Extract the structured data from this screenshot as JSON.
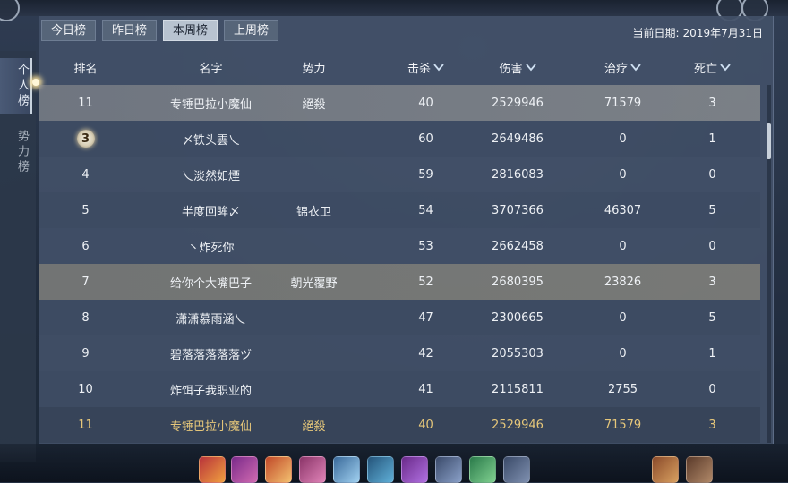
{
  "tabs": [
    {
      "label": "今日榜",
      "active": false
    },
    {
      "label": "昨日榜",
      "active": false
    },
    {
      "label": "本周榜",
      "active": true
    },
    {
      "label": "上周榜",
      "active": false
    }
  ],
  "date": {
    "label": "当前日期:",
    "value": "2019年7月31日"
  },
  "side_tabs": [
    {
      "label": "个人榜",
      "active": true
    },
    {
      "label": "势力榜",
      "active": false
    }
  ],
  "columns": {
    "rank": "排名",
    "name": "名字",
    "faction": "势力",
    "kills": "击杀",
    "damage": "伤害",
    "healing": "治疗",
    "deaths": "死亡"
  },
  "rows": [
    {
      "rank": "11",
      "name": "专锤巴拉小魔仙",
      "faction": "絕殺",
      "kills": "40",
      "damage": "2529946",
      "healing": "71579",
      "deaths": "3",
      "style": "highlight"
    },
    {
      "rank": "3",
      "name": "〆铁头雲乀",
      "faction": "",
      "kills": "60",
      "damage": "2649486",
      "healing": "0",
      "deaths": "1",
      "style": "alt",
      "badge": true
    },
    {
      "rank": "4",
      "name": "乀淡然如煙",
      "faction": "",
      "kills": "59",
      "damage": "2816083",
      "healing": "0",
      "deaths": "0",
      "style": ""
    },
    {
      "rank": "5",
      "name": "半度回眸〆",
      "faction": "锦衣卫",
      "kills": "54",
      "damage": "3707366",
      "healing": "46307",
      "deaths": "5",
      "style": "alt"
    },
    {
      "rank": "6",
      "name": "丶炸死你",
      "faction": "",
      "kills": "53",
      "damage": "2662458",
      "healing": "0",
      "deaths": "0",
      "style": ""
    },
    {
      "rank": "7",
      "name": "给你个大嘴巴子",
      "faction": "朝光覆野",
      "kills": "52",
      "damage": "2680395",
      "healing": "23826",
      "deaths": "3",
      "style": "mine"
    },
    {
      "rank": "8",
      "name": "潇潇慕雨涵乀",
      "faction": "",
      "kills": "47",
      "damage": "2300665",
      "healing": "0",
      "deaths": "5",
      "style": "alt"
    },
    {
      "rank": "9",
      "name": "碧落落落落落ヅ",
      "faction": "",
      "kills": "42",
      "damage": "2055303",
      "healing": "0",
      "deaths": "1",
      "style": ""
    },
    {
      "rank": "10",
      "name": "炸饵子我职业的",
      "faction": "",
      "kills": "41",
      "damage": "2115811",
      "healing": "2755",
      "deaths": "0",
      "style": "alt"
    },
    {
      "rank": "11",
      "name": "专锤巴拉小魔仙",
      "faction": "絕殺",
      "kills": "40",
      "damage": "2529946",
      "healing": "71579",
      "deaths": "3",
      "style": "self-bottom"
    }
  ]
}
